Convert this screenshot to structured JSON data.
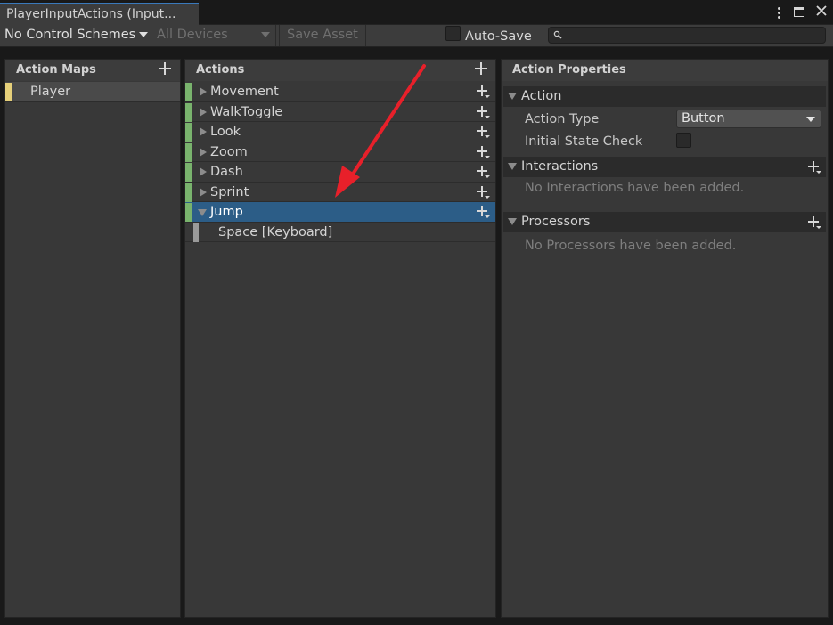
{
  "window": {
    "tab_title": "PlayerInputActions (Input..."
  },
  "toolbar": {
    "control_schemes": "No Control Schemes",
    "devices": "All Devices",
    "save_asset": "Save Asset",
    "auto_save": "Auto-Save",
    "search_placeholder": ""
  },
  "action_maps": {
    "header": "Action Maps",
    "items": [
      {
        "label": "Player",
        "bar_color": "#e6d07a"
      }
    ]
  },
  "actions": {
    "header": "Actions",
    "items": [
      {
        "label": "Movement"
      },
      {
        "label": "WalkToggle"
      },
      {
        "label": "Look"
      },
      {
        "label": "Zoom"
      },
      {
        "label": "Dash"
      },
      {
        "label": "Sprint"
      },
      {
        "label": "Jump",
        "expanded": true,
        "selected": true
      }
    ],
    "binding": {
      "label": "Space [Keyboard]"
    },
    "action_bar_color": "#79b36d",
    "binding_bar_color": "#9a9a9a"
  },
  "properties": {
    "header": "Action Properties",
    "action_section": "Action",
    "action_type_label": "Action Type",
    "action_type_value": "Button",
    "initial_state_label": "Initial State Check",
    "interactions_section": "Interactions",
    "interactions_empty": "No Interactions have been added.",
    "processors_section": "Processors",
    "processors_empty": "No Processors have been added."
  },
  "colors": {
    "selection": "#2c5d87",
    "annotation_arrow": "#e8202a"
  }
}
